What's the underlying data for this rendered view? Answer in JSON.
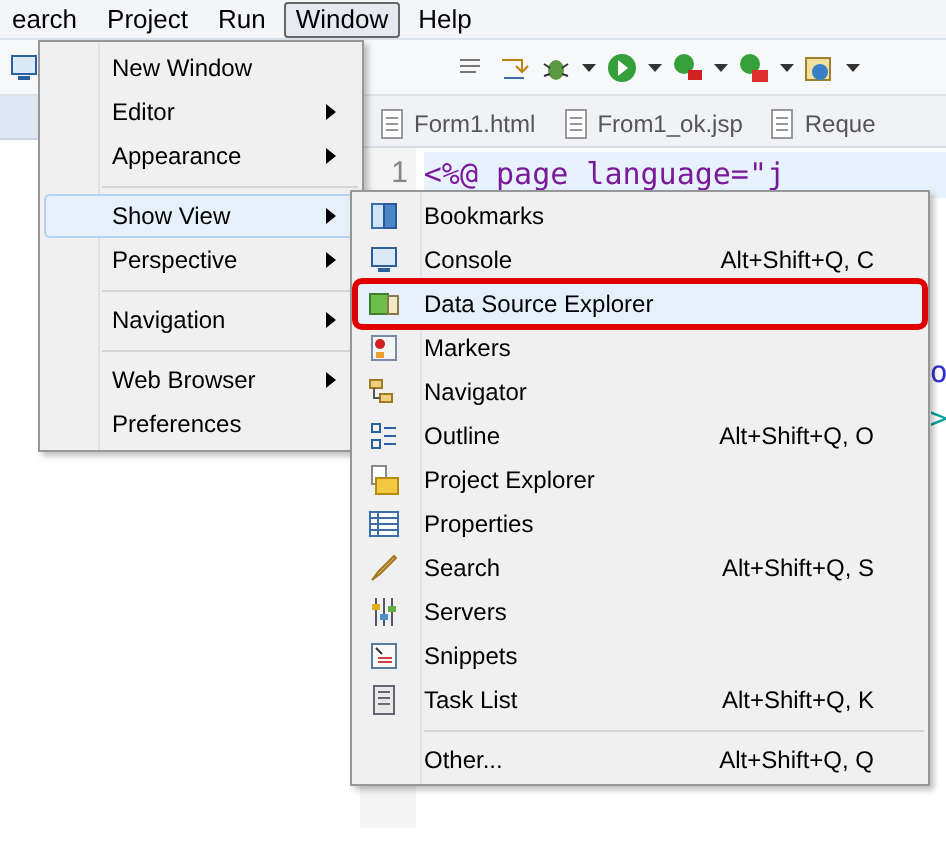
{
  "menubar": [
    {
      "label": "earch",
      "selected": false
    },
    {
      "label": "Project",
      "selected": false
    },
    {
      "label": "Run",
      "selected": false
    },
    {
      "label": "Window",
      "selected": true
    },
    {
      "label": "Help",
      "selected": false
    }
  ],
  "editor": {
    "tabs": [
      "Form1.html",
      "From1_ok.jsp",
      "Reque"
    ],
    "line_number": "1",
    "code": "<%@ page language=\"j",
    "fragments": [
      "o",
      ">"
    ]
  },
  "window_menu": [
    {
      "kind": "item",
      "label": "New Window",
      "submenu": false,
      "selected": false
    },
    {
      "kind": "item",
      "label": "Editor",
      "submenu": true,
      "selected": false
    },
    {
      "kind": "item",
      "label": "Appearance",
      "submenu": true,
      "selected": false
    },
    {
      "kind": "separator"
    },
    {
      "kind": "item",
      "label": "Show View",
      "submenu": true,
      "selected": true
    },
    {
      "kind": "item",
      "label": "Perspective",
      "submenu": true,
      "selected": false
    },
    {
      "kind": "separator"
    },
    {
      "kind": "item",
      "label": "Navigation",
      "submenu": true,
      "selected": false
    },
    {
      "kind": "separator"
    },
    {
      "kind": "item",
      "label": "Web Browser",
      "submenu": true,
      "selected": false
    },
    {
      "kind": "item",
      "label": "Preferences",
      "submenu": false,
      "selected": false
    }
  ],
  "show_view_menu": [
    {
      "kind": "item",
      "label": "Bookmarks",
      "selected": false,
      "outlined": false
    },
    {
      "kind": "item",
      "label": "Console",
      "shortcut": "Alt+Shift+Q, C",
      "selected": false,
      "outlined": false
    },
    {
      "kind": "item",
      "label": "Data Source Explorer",
      "selected": true,
      "outlined": true
    },
    {
      "kind": "item",
      "label": "Markers",
      "selected": false,
      "outlined": false
    },
    {
      "kind": "item",
      "label": "Navigator",
      "selected": false,
      "outlined": false
    },
    {
      "kind": "item",
      "label": "Outline",
      "shortcut": "Alt+Shift+Q, O",
      "selected": false,
      "outlined": false
    },
    {
      "kind": "item",
      "label": "Project Explorer",
      "selected": false,
      "outlined": false
    },
    {
      "kind": "item",
      "label": "Properties",
      "selected": false,
      "outlined": false
    },
    {
      "kind": "item",
      "label": "Search",
      "shortcut": "Alt+Shift+Q, S",
      "selected": false,
      "outlined": false
    },
    {
      "kind": "item",
      "label": "Servers",
      "selected": false,
      "outlined": false
    },
    {
      "kind": "item",
      "label": "Snippets",
      "selected": false,
      "outlined": false
    },
    {
      "kind": "item",
      "label": "Task List",
      "shortcut": "Alt+Shift+Q, K",
      "selected": false,
      "outlined": false
    },
    {
      "kind": "separator"
    },
    {
      "kind": "item",
      "label": "Other...",
      "shortcut": "Alt+Shift+Q, Q",
      "selected": false,
      "outlined": false
    }
  ]
}
